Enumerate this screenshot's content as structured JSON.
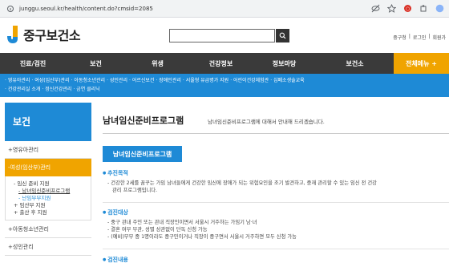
{
  "browser": {
    "url": "junggu.seoul.kr/health/content.do?cmsid=2085"
  },
  "header": {
    "logo_text": "중구보건소",
    "util_links": [
      "중구청",
      "로그인",
      "회원가"
    ]
  },
  "gnb": {
    "items": [
      "진료/검진",
      "보건",
      "위생",
      "건강정보",
      "정보마당",
      "보건소"
    ],
    "all_menu": "전체메뉴 +"
  },
  "submenu": {
    "row1": [
      "영유아관리",
      "여성(임산부)관리",
      "아동청소년관리",
      "성인관리",
      "어르신보건",
      "장애인관리",
      "서울형 유급병가 지원",
      "어린이건강체험관",
      "심폐소생술교육"
    ],
    "row2": [
      "건강관리실 소개",
      "정신건강관리",
      "금연 클리닉"
    ]
  },
  "sidebar": {
    "title": "보건",
    "items": [
      "영유아관리",
      "여성(임산부)관리",
      "아동청소년관리",
      "성인관리"
    ],
    "sub": {
      "l1_a": "임신 준비 지원",
      "l2_a": "남녀임신준비프로그램",
      "l2_b": "난임부부지원",
      "l1_b": "임산부 지원",
      "l1_c": "출산 후 지원"
    }
  },
  "content": {
    "title": "남녀임신준비프로그램",
    "desc": "남녀임신준비프로그램에 대해서 안내해 드리겠습니다.",
    "badge": "남녀임신준비프로그램",
    "sections": [
      {
        "title": "추진목적",
        "lines": [
          "건강한 2세를 꿈꾸는 가임 남녀들에게 건강한 임신에 장애가 되는 위험요인을 조기 발견하고, 중재 관리할 수 있는 임신 전 건강",
          "관리 프로그램입니다."
        ]
      },
      {
        "title": "검진대상",
        "lines": [
          "중구 관내 주민 또는 관내 직장인이면서 서울시 거주하는 가임기 남·녀",
          "결혼 여부 무관, 성별 상관없이 단독 신청 가능",
          "(예비)부부 중 1명이라도 중구민이거나 직장이 중구면서 서울시 거주하면 모두 신청 가능"
        ]
      },
      {
        "title": "검진내용",
        "lines": []
      }
    ]
  },
  "colors": {
    "brand_blue": "#1e8ad6",
    "accent_orange": "#f0a400",
    "gnb_dark": "#3a3a3a"
  }
}
